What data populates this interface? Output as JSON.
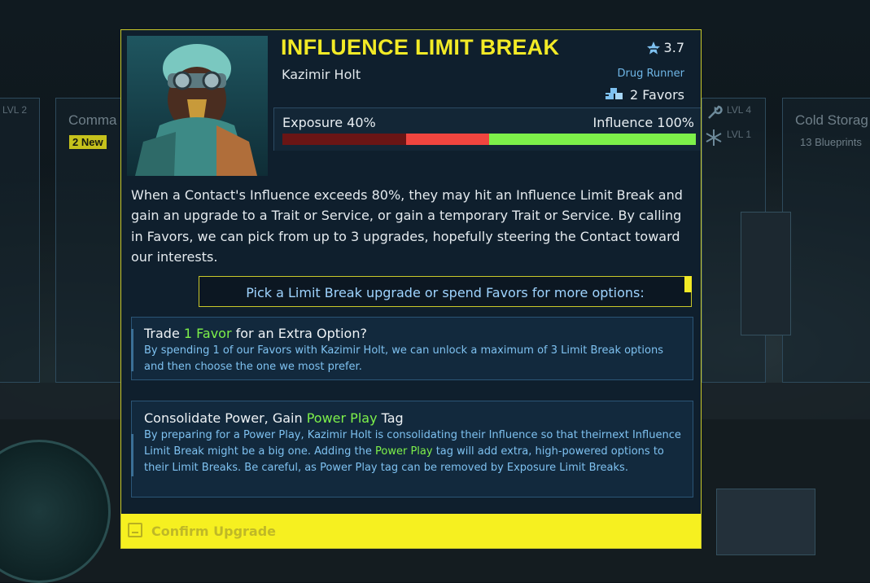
{
  "background": {
    "left_panel_level": "LVL 2",
    "command_panel_title": "Comma",
    "command_badge": "2 New",
    "right_level_1": "LVL 4",
    "right_level_2": "LVL 1",
    "cold_storage_title": "Cold Storag",
    "cold_storage_sub": "13 Blueprints"
  },
  "dialog": {
    "title": "INFLUENCE LIMIT BREAK",
    "rating": "3.7",
    "contact_name": "Kazimir Holt",
    "role": "Drug Runner",
    "favors": "2 Favors",
    "exposure_label": "Exposure 40%",
    "influence_label": "Influence 100%",
    "exposure_fraction": 0.4,
    "influence_fraction": 1.0,
    "description": "When a Contact's Influence exceeds 80%, they may hit an Influence Limit Break and gain an upgrade to a Trait or Service, or gain a temporary Trait or Service. By calling in Favors, we can pick from up to 3 upgrades, hopefully steering the Contact toward our interests.",
    "banner": "Pick a Limit Break upgrade or spend Favors for more options:",
    "options": [
      {
        "title_pre": "Trade ",
        "title_hl": "1 Favor",
        "title_post": " for an Extra Option?",
        "body": "By spending 1 of our Favors with Kazimir Holt, we can unlock a maximum of 3 Limit Break options and then choose the one we most prefer."
      },
      {
        "title_pre": "Consolidate Power, Gain ",
        "title_hl": "Power Play",
        "title_post": " Tag",
        "body_pre": "By preparing for a Power Play, Kazimir Holt is consolidating their Influence so that theirnext Influence Limit Break might be a big one. Adding the ",
        "body_hl": "Power Play",
        "body_post": " tag will add extra, high-powered options to their Limit Breaks. Be careful, as Power Play tag can be removed by Exposure Limit Breaks."
      }
    ],
    "confirm_label": "Confirm Upgrade"
  },
  "colors": {
    "accent_yellow": "#f2ea26",
    "exposure_dark": "#6a1515",
    "exposure_red": "#f0453f",
    "influence_green": "#7df04a",
    "info_blue": "#7ec1f0"
  },
  "icons": [
    "star-rating-icon",
    "favors-icon",
    "confirm-key-icon",
    "wrench-icon",
    "snowflake-icon"
  ]
}
